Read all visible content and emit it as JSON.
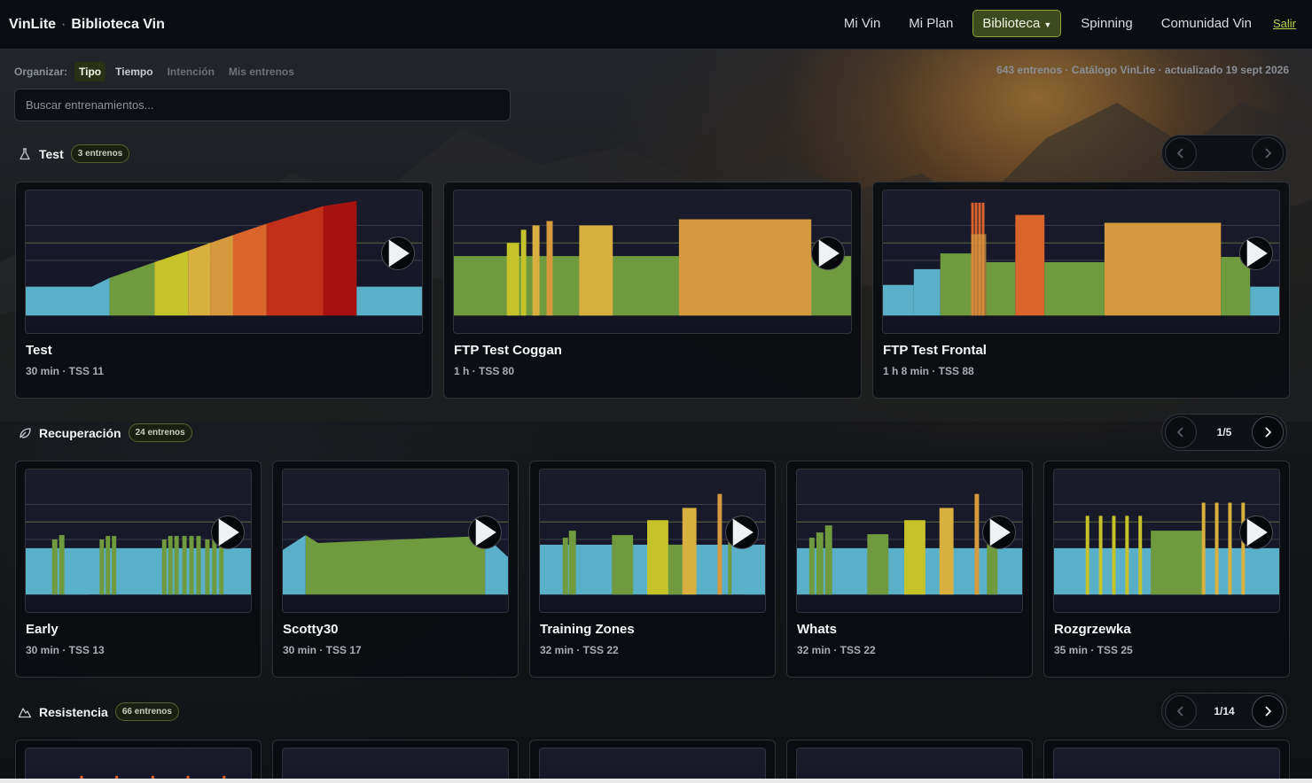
{
  "header": {
    "brand": "VinLite",
    "separator": "·",
    "section": "Biblioteca Vin",
    "nav": [
      "Mi Vin",
      "Mi Plan",
      "Biblioteca",
      "Spinning",
      "Comunidad Vin"
    ],
    "logout": "Salir",
    "active_nav": "Biblioteca",
    "accent_color": "#8aa33a"
  },
  "toolbar": {
    "label": "Organizar:",
    "options": [
      "Tipo",
      "Tiempo",
      "Intención",
      "Mis entrenos"
    ],
    "selected": "Tipo",
    "meta": "643 entrenos · Catálogo VinLite · actualizado 19 sept 2026"
  },
  "search": {
    "placeholder": "Buscar entrenamientos...",
    "value": ""
  },
  "sections": [
    {
      "title": "Test",
      "count": "3 entrenos",
      "icon": "flask-icon",
      "pager": "",
      "cards": [
        {
          "name": "Test",
          "sub": "30 min · TSS 11"
        },
        {
          "name": "FTP Test Coggan",
          "sub": "1 h · TSS 80"
        },
        {
          "name": "FTP Test Frontal",
          "sub": "1 h 8 min · TSS 88"
        }
      ]
    },
    {
      "title": "Recuperación",
      "count": "24 entrenos",
      "icon": "leaf-icon",
      "pager": "1/5",
      "cards": [
        {
          "name": "Early",
          "sub": "30 min · TSS 13"
        },
        {
          "name": "Scotty30",
          "sub": "30 min · TSS 17"
        },
        {
          "name": "Training Zones",
          "sub": "32 min · TSS 22"
        },
        {
          "name": "Whats",
          "sub": "32 min · TSS 22"
        },
        {
          "name": "Rozgrzewka",
          "sub": "35 min · TSS 25"
        }
      ]
    },
    {
      "title": "Resistencia",
      "count": "66 entrenos",
      "icon": "mountain-icon",
      "pager": "1/14",
      "cards": []
    }
  ],
  "zone_colors": {
    "z1": "#5ab0c8",
    "z2": "#6f9a3e",
    "z3": "#c6c22a",
    "z4": "#d59a3e",
    "z5": "#d9642c",
    "z6": "#c3301a",
    "z7": "#a5120f"
  }
}
